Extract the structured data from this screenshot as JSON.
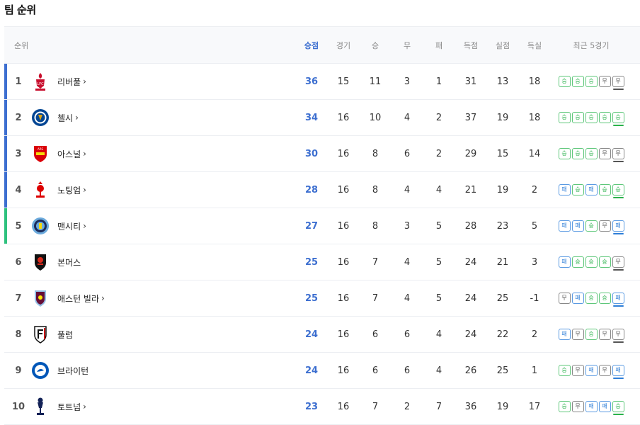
{
  "page": {
    "title": "팀 순위"
  },
  "columns": {
    "rank": "순위",
    "points": "승점",
    "played": "경기",
    "won": "승",
    "drawn": "무",
    "lost": "패",
    "goals_for": "득점",
    "goals_against": "실점",
    "goal_diff": "득실",
    "form": "최근 5경기"
  },
  "chevron": "›",
  "colors": {
    "accent_points": "#3d6fd0",
    "champions_league": "#3d6fd0",
    "europa_league": "#2ec27e",
    "win": "#2bb24c",
    "draw": "#555555",
    "loss": "#2f7fd8"
  },
  "rows": [
    {
      "rank": "1",
      "name": "리버풀",
      "link": true,
      "points": "36",
      "played": "15",
      "won": "11",
      "drawn": "3",
      "lost": "1",
      "gf": "31",
      "ga": "13",
      "gd": "18",
      "zone": "ucl",
      "logo": "liverpool-crest-icon",
      "form": [
        "승",
        "승",
        "승",
        "무",
        "무"
      ]
    },
    {
      "rank": "2",
      "name": "첼시",
      "link": true,
      "points": "34",
      "played": "16",
      "won": "10",
      "drawn": "4",
      "lost": "2",
      "gf": "37",
      "ga": "19",
      "gd": "18",
      "zone": "ucl",
      "logo": "chelsea-crest-icon",
      "form": [
        "승",
        "승",
        "승",
        "승",
        "승"
      ]
    },
    {
      "rank": "3",
      "name": "아스널",
      "link": true,
      "points": "30",
      "played": "16",
      "won": "8",
      "drawn": "6",
      "lost": "2",
      "gf": "29",
      "ga": "15",
      "gd": "14",
      "zone": "ucl",
      "logo": "arsenal-crest-icon",
      "form": [
        "승",
        "승",
        "승",
        "무",
        "무"
      ]
    },
    {
      "rank": "4",
      "name": "노팅엄",
      "link": true,
      "points": "28",
      "played": "16",
      "won": "8",
      "drawn": "4",
      "lost": "4",
      "gf": "21",
      "ga": "19",
      "gd": "2",
      "zone": "ucl",
      "logo": "nottingham-crest-icon",
      "form": [
        "패",
        "승",
        "패",
        "승",
        "승"
      ]
    },
    {
      "rank": "5",
      "name": "맨시티",
      "link": true,
      "points": "27",
      "played": "16",
      "won": "8",
      "drawn": "3",
      "lost": "5",
      "gf": "28",
      "ga": "23",
      "gd": "5",
      "zone": "uel",
      "logo": "mancity-crest-icon",
      "form": [
        "패",
        "패",
        "승",
        "무",
        "패"
      ]
    },
    {
      "rank": "6",
      "name": "본머스",
      "link": false,
      "points": "25",
      "played": "16",
      "won": "7",
      "drawn": "4",
      "lost": "5",
      "gf": "24",
      "ga": "21",
      "gd": "3",
      "zone": "none",
      "logo": "bournemouth-crest-icon",
      "form": [
        "패",
        "승",
        "승",
        "승",
        "무"
      ]
    },
    {
      "rank": "7",
      "name": "애스턴 빌라",
      "link": true,
      "points": "25",
      "played": "16",
      "won": "7",
      "drawn": "4",
      "lost": "5",
      "gf": "24",
      "ga": "25",
      "gd": "-1",
      "zone": "none",
      "logo": "astonvilla-crest-icon",
      "form": [
        "무",
        "패",
        "승",
        "승",
        "패"
      ]
    },
    {
      "rank": "8",
      "name": "풀럼",
      "link": false,
      "points": "24",
      "played": "16",
      "won": "6",
      "drawn": "6",
      "lost": "4",
      "gf": "24",
      "ga": "22",
      "gd": "2",
      "zone": "none",
      "logo": "fulham-crest-icon",
      "form": [
        "패",
        "무",
        "승",
        "무",
        "무"
      ]
    },
    {
      "rank": "9",
      "name": "브라이턴",
      "link": false,
      "points": "24",
      "played": "16",
      "won": "6",
      "drawn": "6",
      "lost": "4",
      "gf": "26",
      "ga": "25",
      "gd": "1",
      "zone": "none",
      "logo": "brighton-crest-icon",
      "form": [
        "승",
        "무",
        "패",
        "무",
        "패"
      ]
    },
    {
      "rank": "10",
      "name": "토트넘",
      "link": true,
      "points": "23",
      "played": "16",
      "won": "7",
      "drawn": "2",
      "lost": "7",
      "gf": "36",
      "ga": "19",
      "gd": "17",
      "zone": "none",
      "logo": "tottenham-crest-icon",
      "form": [
        "승",
        "무",
        "패",
        "패",
        "승"
      ]
    }
  ]
}
